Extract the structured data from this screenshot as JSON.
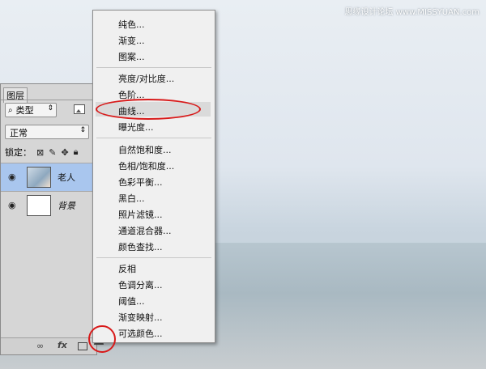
{
  "watermark": "思缘设计论坛 www.MISSYUAN.com",
  "layers_panel": {
    "tab_label": "图层",
    "filter_kind": "类型",
    "blend_mode": "正常",
    "lock_label": "锁定：",
    "layers": [
      {
        "name": "老人"
      },
      {
        "name": "背景"
      }
    ]
  },
  "adjustment_menu": {
    "groups": [
      [
        "纯色...",
        "渐变...",
        "图案..."
      ],
      [
        "亮度/对比度...",
        "色阶...",
        "曲线...",
        "曝光度..."
      ],
      [
        "自然饱和度...",
        "色相/饱和度...",
        "色彩平衡...",
        "黑白...",
        "照片滤镜...",
        "通道混合器...",
        "颜色查找..."
      ],
      [
        "反相",
        "色调分离...",
        "阈值...",
        "渐变映射...",
        "可选颜色..."
      ]
    ]
  },
  "colors": {
    "annotation": "#d81a1a",
    "selected_layer": "#a9c6ee"
  }
}
